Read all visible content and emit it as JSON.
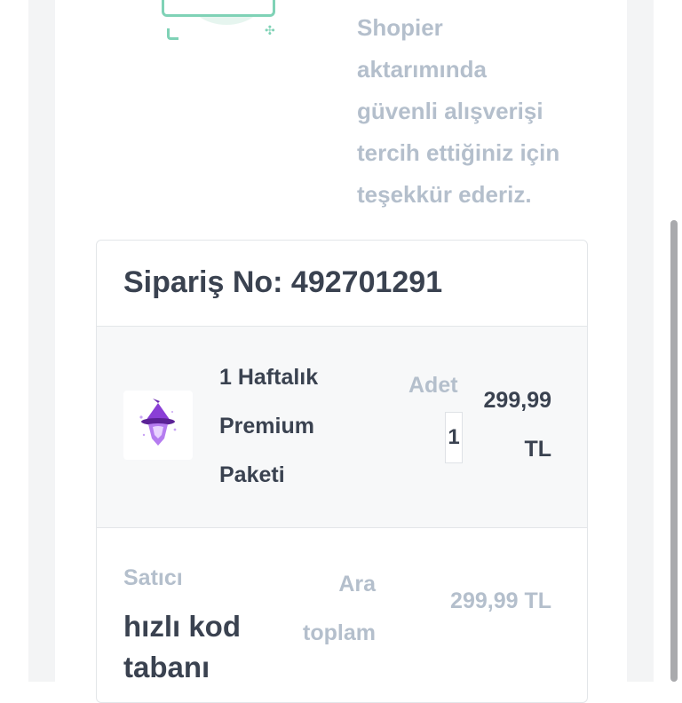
{
  "thanks_message": {
    "line1": "Shopier",
    "line2": "aktarımında",
    "line3": "güvenli alışverişi",
    "line4": "tercih ettiğiniz için",
    "line5": "teşekkür ederiz."
  },
  "order": {
    "title": "Sipariş No: 492701291",
    "product": {
      "name_line1": "1 Haftalık",
      "name_line2": "Premium",
      "name_line3": "Paketi",
      "thumbnail_icon": "wizard-hat-icon",
      "quantity_label": "Adet",
      "quantity_value": "1",
      "price_line1": "299,99",
      "price_line2": "TL"
    },
    "seller": {
      "label": "Satıcı",
      "name_line1": "hızlı kod",
      "name_line2": "tabanı"
    },
    "subtotal": {
      "label_line1": "Ara",
      "label_line2": "toplam",
      "value": "299,99 TL"
    }
  },
  "colors": {
    "accent_mint": "#7fd2b6",
    "muted_text": "#b4bfcc",
    "dark_text": "#3a4250",
    "wizard_purple": "#8a3fd6"
  }
}
